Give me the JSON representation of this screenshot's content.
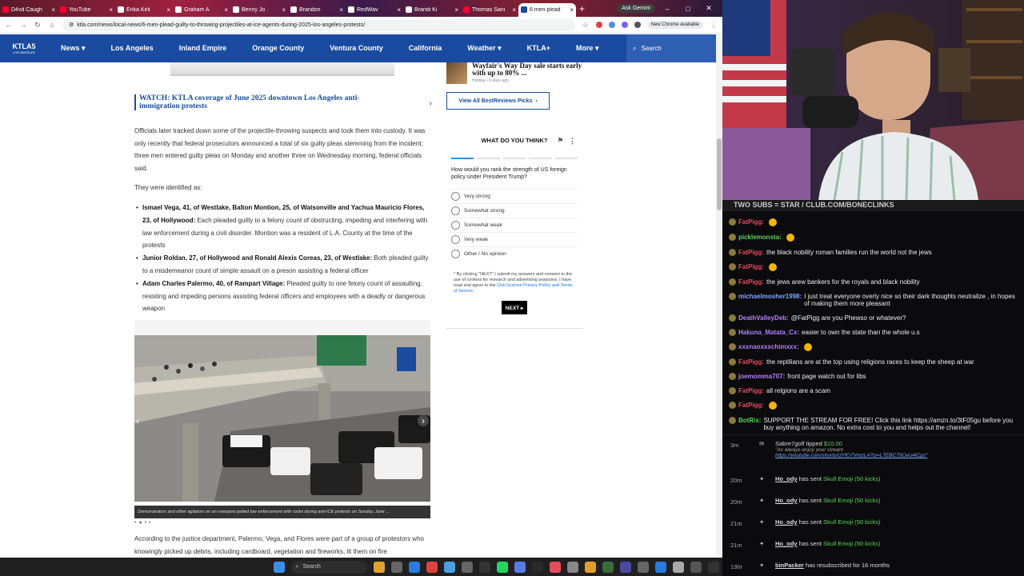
{
  "browser": {
    "tabs": [
      {
        "label": "D4vd Caugh",
        "color": "#ff0033"
      },
      {
        "label": "YouTube",
        "color": "#ff0033"
      },
      {
        "label": "Erika Kirk",
        "color": "#ffffff"
      },
      {
        "label": "Graham A",
        "color": "#ffffff"
      },
      {
        "label": "Benny Jo",
        "color": "#ffffff"
      },
      {
        "label": "Brandon",
        "color": "#ffffff"
      },
      {
        "label": "RedWav",
        "color": "#ffffff"
      },
      {
        "label": "Brandi Ki",
        "color": "#ffffff"
      },
      {
        "label": "Thomas Sani",
        "color": "#ff0033"
      },
      {
        "label": "6 men plead",
        "color": "#1a4ba0",
        "active": true
      }
    ],
    "ask_gemini": "Ask Gemini",
    "url": "ktla.com/news/local-news/6-men-plead-guilty-to-throwing-projectiles-at-ice-agents-during-2025-los-angeles-protests/",
    "new_chrome": "New Chrome available"
  },
  "site": {
    "logo_text": "KTLA5",
    "logo_sub": "LOS ANGELES",
    "nav": [
      "News ▾",
      "Los Angeles",
      "Inland Empire",
      "Orange County",
      "Ventura County",
      "California",
      "Weather ▾",
      "KTLA+",
      "More ▾"
    ],
    "search": "Search"
  },
  "article": {
    "watch": "WATCH: KTLA coverage of June 2025 downtown Los Angeles anti-immigration protests",
    "p1": "Officials later tracked down some of the projectile-throwing suspects and took them into custody. It was only recently that federal prosecutors announced a total of six guilty pleas stemming from the incident; three men entered guilty pleas on Monday and another three on Wednesday morning, federal officials said.",
    "p2": "They were identified as:",
    "bullets": [
      {
        "bold": "Ismael Vega, 41, of Westlake, Balton Montion, 25, of Watsonville and Yachua Mauricio Flores, 23, of Hollywood:",
        "text": " Each pleaded guilty to a felony count of obstructing, impeding and interfering with law enforcement during a civil disorder. Montion was a resident of L.A. County at the time of the protests"
      },
      {
        "bold": "Junior Roldan, 27, of Hollywood and Ronald Alexis Coreas, 23, of Westlake:",
        "text": " Both pleaded guilty to a misdemeanor count of simple assault on a preson assisting a federal officer"
      },
      {
        "bold": "Adam Charles Palermo, 40, of Rampart Village:",
        "text": " Pleaded guilty to one felony count of assaulting, resisting and impeding persons assisting federal officers and employees with a deadly or dangerous weapon"
      }
    ],
    "caption": "Demonstrators and other agitators on an overpass pelted law enforcement with rocks during anti-ICE protests on Sunday, June ...",
    "p3": "According to the justice department, Palermo, Vega, and Flores were part of a group of protestors who knowingly picked up debris, including cardboard, vegetation and fireworks, lit them on fire"
  },
  "sidebar": {
    "ad_title": "Wayfair's Way Day sale starts early with up to 80% ...",
    "ad_src": "Holiday • 6 days ago",
    "br_button": "View All BestReviews Picks",
    "poll_title": "WHAT DO YOU THINK?",
    "poll_q": "How would you rank the strength of US foreign policy under President Trump?",
    "options": [
      "Very strong",
      "Somewhat strong",
      "Somewhat weak",
      "Very weak",
      "Other / No opinion"
    ],
    "fine_a": "* By clicking \"NEXT\" I submit my answers and consent to the use of cookies for research and advertising purposes; I have read and agree to the ",
    "fine_link": "CivicScience Privacy Policy and Terms of Service",
    "next": "NEXT ▸"
  },
  "stream": {
    "banner": "TWO SUBS = STAR / CLUB.COM/BONECLINKS",
    "messages": [
      {
        "user": "FatPigg:",
        "color": "#e84a5f",
        "text": "",
        "emoji": true
      },
      {
        "user": "picklemonsta:",
        "color": "#5bd35b",
        "text": "",
        "emoji": true
      },
      {
        "user": "FatPigg:",
        "color": "#e84a5f",
        "text": "the black nobility roman families run the world not the jews"
      },
      {
        "user": "FatPigg:",
        "color": "#e84a5f",
        "text": "",
        "emoji": true
      },
      {
        "user": "FatPigg:",
        "color": "#e84a5f",
        "text": "the jews arew bankers for the royals and black nobility"
      },
      {
        "user": "michaelmosher1998:",
        "color": "#7fa7ff",
        "text": "I just treat everyone overly nice so their dark thoughts neutralize , in hopes of making them more pleasant"
      },
      {
        "user": "DeathValleyDeb:",
        "color": "#b57fff",
        "text": "@FatPigg are you Phewso or whatever?"
      },
      {
        "user": "Hakuna_Matata_Cx:",
        "color": "#b57fff",
        "text": "easier to own the state than the whole u.s"
      },
      {
        "user": "xxxnaoxxxchimxxx:",
        "color": "#b57fff",
        "text": "",
        "emoji": true
      },
      {
        "user": "FatPigg:",
        "color": "#e84a5f",
        "text": "the reptilians are at the top using religions races to keep the sheep at war"
      },
      {
        "user": "joemomma707:",
        "color": "#b57fff",
        "text": "front page watch out for libs"
      },
      {
        "user": "FatPigg:",
        "color": "#e84a5f",
        "text": "all relgions are a scam"
      },
      {
        "user": "FatPigg:",
        "color": "#e84a5f",
        "text": "",
        "emoji": true
      },
      {
        "user": "BotRix:",
        "color": "#5bd35b",
        "text": "SUPPORT THE STREAM FOR FREE! Click this link https://amzn.to/3tF05gu before you buy anything on amazon. No extra cost to you and helps out the channel!"
      }
    ],
    "gift": {
      "time": "3m",
      "user": "Sabre7golf",
      "action": " tipped ",
      "amount": "$10.00",
      "note": "\"As always enjoy your stream",
      "link": "https://youtube.com/shorts/UYfO7VmzLA?si=L7EBC75CeU4lCpz\""
    },
    "events": [
      {
        "time": "20m",
        "user": "Ho_ody",
        "action": " has sent ",
        "item": "Skull Emoji (50 kicks)"
      },
      {
        "time": "20m",
        "user": "Ho_ody",
        "action": " has sent ",
        "item": "Skull Emoji (50 kicks)"
      },
      {
        "time": "21m",
        "user": "Ho_ody",
        "action": " has sent ",
        "item": "Skull Emoji (50 kicks)"
      },
      {
        "time": "21m",
        "user": "Ho_ody",
        "action": " has sent ",
        "item": "Skull Emoji (50 kicks)"
      },
      {
        "time": "13hr",
        "user": "binPacker",
        "action": " has resubscribed for 16 months",
        "item": ""
      }
    ]
  },
  "taskbar": {
    "search": "Search"
  }
}
